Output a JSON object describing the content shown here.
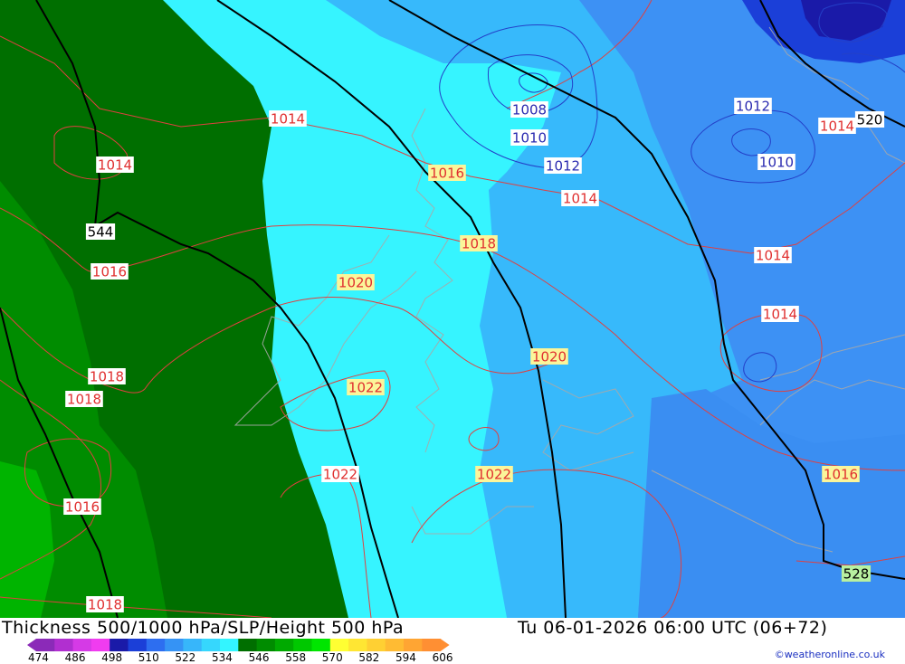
{
  "header": {
    "title": "Thickness 500/1000 hPa/SLP/Height 500 hPa",
    "datetime": "Tu 06-01-2026 06:00 UTC (06+72)",
    "credit": "©weatheronline.co.uk"
  },
  "legend": {
    "ticks": [
      "474",
      "486",
      "498",
      "510",
      "522",
      "534",
      "546",
      "558",
      "570",
      "582",
      "594",
      "606"
    ],
    "colors": [
      "#8b2ab8",
      "#b12fd0",
      "#d53ae6",
      "#f03cf0",
      "#1a1aa8",
      "#1b3fd8",
      "#2d6ef0",
      "#3593f5",
      "#37b6fa",
      "#36d7fd",
      "#33f5ff",
      "#006f00",
      "#008c00",
      "#00aa00",
      "#00c800",
      "#00e600",
      "#ffff33",
      "#ffe633",
      "#ffd033",
      "#ffbb33",
      "#ffa533",
      "#ff8f33"
    ]
  },
  "map_labels": {
    "slp": [
      {
        "text": "1014",
        "style": "red"
      },
      {
        "text": "1014",
        "style": "red"
      },
      {
        "text": "1016",
        "style": "red"
      },
      {
        "text": "1018",
        "style": "red"
      },
      {
        "text": "1018",
        "style": "red"
      },
      {
        "text": "1016",
        "style": "red"
      },
      {
        "text": "1018",
        "style": "red"
      },
      {
        "text": "1008",
        "style": "blue"
      },
      {
        "text": "1010",
        "style": "blue"
      },
      {
        "text": "1012",
        "style": "blue"
      },
      {
        "text": "1012",
        "style": "blue"
      },
      {
        "text": "1010",
        "style": "blue"
      },
      {
        "text": "1014",
        "style": "red"
      },
      {
        "text": "1014",
        "style": "red"
      },
      {
        "text": "1014",
        "style": "red"
      },
      {
        "text": "1014",
        "style": "red"
      },
      {
        "text": "1016",
        "style": "yellow"
      },
      {
        "text": "1018",
        "style": "yellow"
      },
      {
        "text": "1020",
        "style": "yellow"
      },
      {
        "text": "1022",
        "style": "yellow"
      },
      {
        "text": "1022",
        "style": "red"
      },
      {
        "text": "1022",
        "style": "yellow"
      },
      {
        "text": "1020",
        "style": "yellow"
      },
      {
        "text": "1016",
        "style": "yellow"
      }
    ],
    "height": [
      {
        "text": "544",
        "style": "white"
      },
      {
        "text": "520",
        "style": "white"
      },
      {
        "text": "528",
        "style": "green"
      }
    ]
  }
}
